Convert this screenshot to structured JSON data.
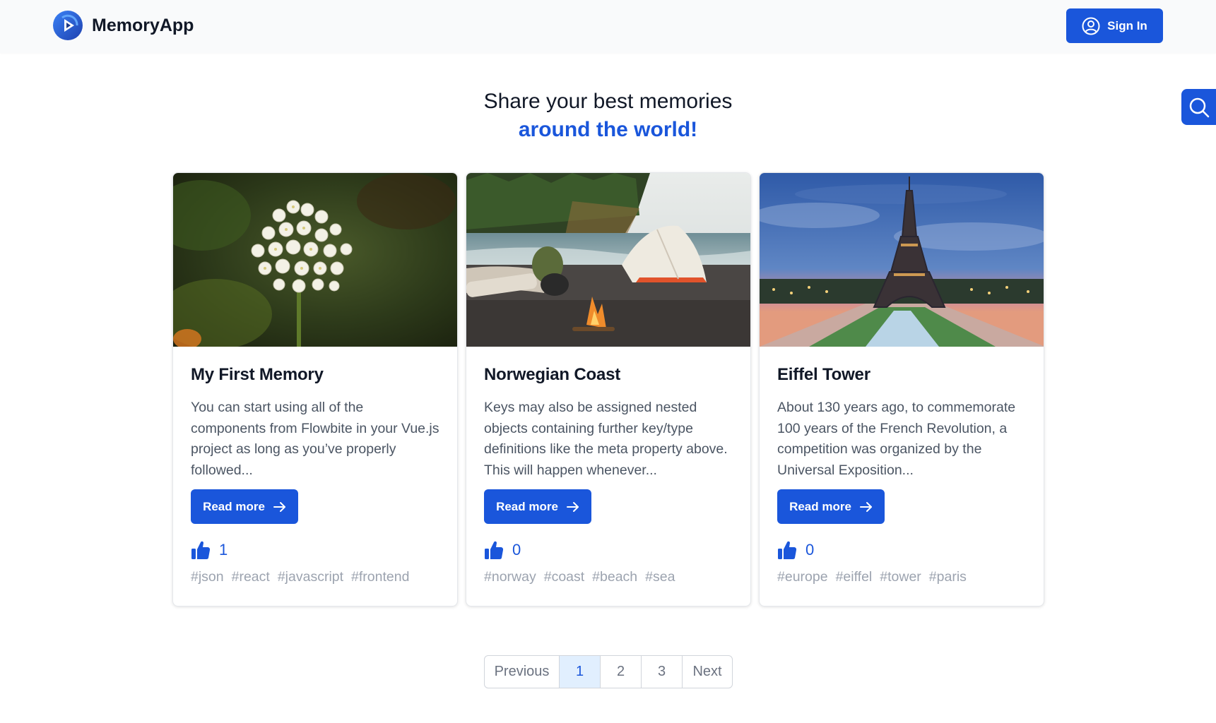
{
  "navbar": {
    "brand_name": "MemoryApp",
    "signin_label": "Sign In",
    "brand_icon": "play-logo-icon",
    "brand_color": "#1a56db"
  },
  "search": {
    "icon": "search-icon"
  },
  "hero": {
    "line1": "Share your best memories",
    "line2": "around the world!"
  },
  "cards": [
    {
      "title": "My First Memory",
      "text": "You can start using all of the components from Flowbite in your Vue.js project as long as you’ve properly followed...",
      "read_more": "Read more",
      "likes": "1",
      "tags": [
        "#json",
        "#react",
        "#javascript",
        "#frontend"
      ],
      "image": "white-flower-photo"
    },
    {
      "title": "Norwegian Coast",
      "text": "Keys may also be assigned nested objects containing further key/type definitions like the meta property above. This will happen whenever...",
      "read_more": "Read more",
      "likes": "0",
      "tags": [
        "#norway",
        "#coast",
        "#beach",
        "#sea"
      ],
      "image": "beach-tent-campfire-photo"
    },
    {
      "title": "Eiffel Tower",
      "text": "About 130 years ago, to commemorate 100 years of the French Revolution, a competition was organized by the Universal Exposition...",
      "read_more": "Read more",
      "likes": "0",
      "tags": [
        "#europe",
        "#eiffel",
        "#tower",
        "#paris"
      ],
      "image": "eiffel-tower-dusk-photo"
    }
  ],
  "pagination": {
    "previous": "Previous",
    "pages": [
      "1",
      "2",
      "3"
    ],
    "active": "1",
    "next": "Next"
  },
  "colors": {
    "accent": "#1a56db",
    "active_page_bg": "#e1effe",
    "muted_text": "#9ca3af"
  }
}
